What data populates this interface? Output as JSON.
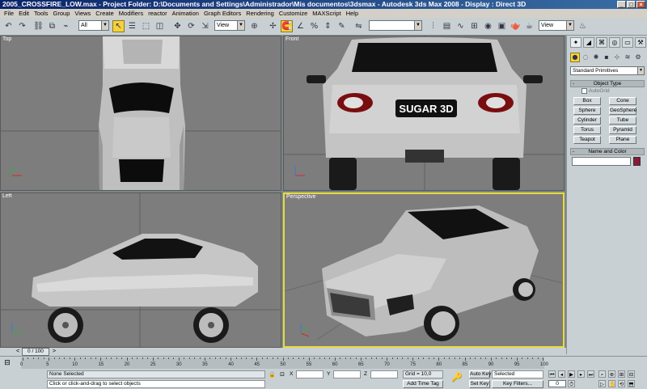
{
  "window": {
    "title": "2005_CROSSFIRE_LOW.max     - Project Folder: D:\\Documents and Settings\\Administrador\\Mis documentos\\3dsmax     - Autodesk 3ds Max 2008     - Display : Direct 3D",
    "minimize": "_",
    "maximize": "□",
    "close": "×"
  },
  "menu": [
    "File",
    "Edit",
    "Tools",
    "Group",
    "Views",
    "Create",
    "Modifiers",
    "reactor",
    "Animation",
    "Graph Editors",
    "Rendering",
    "Customize",
    "MAXScript",
    "Help"
  ],
  "toolbar": {
    "selection_filter": "All",
    "ref_coord": "View",
    "named_selection": "",
    "view_dropdown": "View"
  },
  "viewports": {
    "top": "Top",
    "front": "Front",
    "left": "Left",
    "perspective": "Perspective",
    "plate_text": "SUGAR 3D"
  },
  "command_panel": {
    "category": "Standard Primitives",
    "object_type_title": "Object Type",
    "autogrid": "AutoGrid",
    "buttons": [
      "Box",
      "Cone",
      "Sphere",
      "GeoSphere",
      "Cylinder",
      "Tube",
      "Torus",
      "Pyramid",
      "Teapot",
      "Plane"
    ],
    "name_color_title": "Name and Color",
    "object_color": "#8a1a3a"
  },
  "time": {
    "slider": "0 / 100",
    "ticks": [
      "0",
      "5",
      "10",
      "15",
      "20",
      "25",
      "30",
      "35",
      "40",
      "45",
      "50",
      "55",
      "60",
      "65",
      "70",
      "75",
      "80",
      "85",
      "90",
      "95",
      "100"
    ]
  },
  "status": {
    "selection": "None Selected",
    "prompt": "Click or click-and-drag to select objects",
    "x_label": "X",
    "y_label": "Y",
    "z_label": "Z",
    "grid": "Grid = 10,0",
    "add_time_tag": "Add Time Tag",
    "auto_key": "Auto Key",
    "set_key": "Set Key",
    "key_mode": "Selected",
    "key_filters": "Key Filters...",
    "frame": "0"
  },
  "colors": {
    "active_border": "#e8dc3a",
    "viewport_bg": "#7d7d7d",
    "ui_bg": "#c8d0d4"
  }
}
